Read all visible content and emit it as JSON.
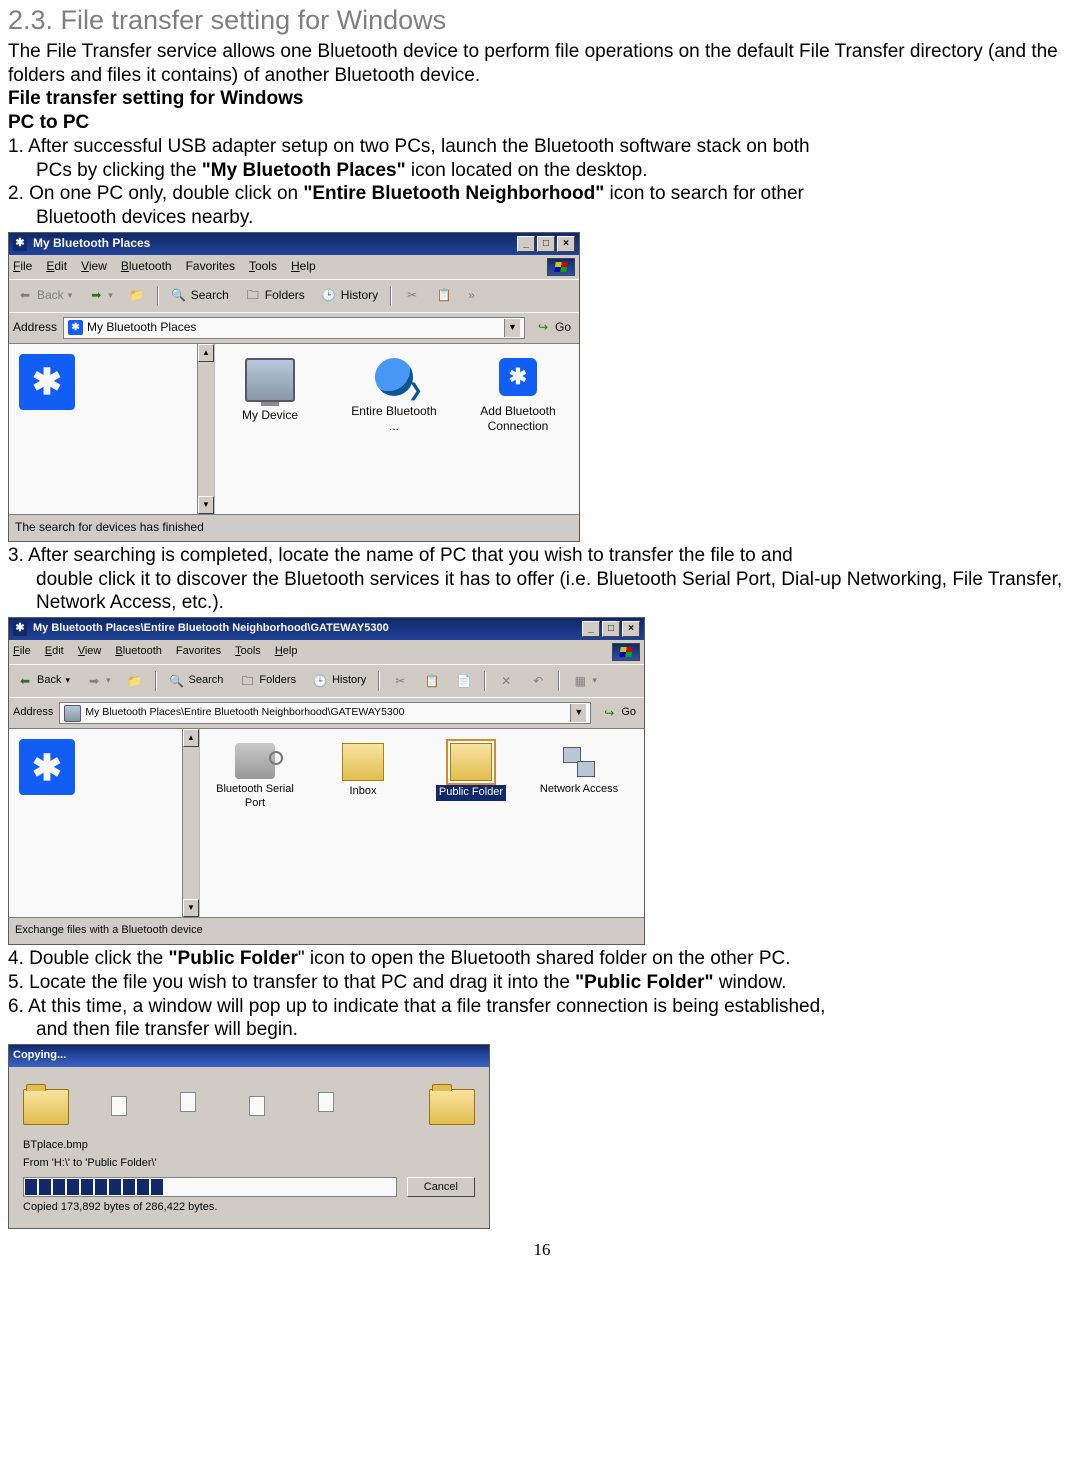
{
  "heading": "2.3. File transfer setting for Windows",
  "intro": "The File Transfer service allows one Bluetooth device to perform file operations on the default File Transfer directory (and the folders and files it contains) of another Bluetooth device.",
  "sub1": "File transfer setting for Windows",
  "sub2": "PC to PC",
  "step1a": "1. After successful USB adapter setup on two PCs, launch the Bluetooth software stack on both",
  "step1b": "PCs by clicking the ",
  "step1bold": "\"My Bluetooth Places\"",
  "step1c": " icon located on the desktop.",
  "step2a": "2. On one PC only, double click on ",
  "step2bold": "\"Entire Bluetooth Neighborhood\"",
  "step2b": " icon to search for other",
  "step2c": "Bluetooth devices nearby.",
  "step3a": "3. After searching is completed, locate the name of PC that you wish to transfer the file to and",
  "step3b": "double click it to discover the Bluetooth services it has to offer (i.e. Bluetooth Serial Port, Dial-up Networking, File Transfer, Network Access, etc.).",
  "step4a": "4. Double click the ",
  "step4bold": "\"Public Folder",
  "step4b": "\" icon to open the Bluetooth shared folder on the other PC.",
  "step5a": "5. Locate the file you wish to transfer to that PC and drag it into the ",
  "step5bold": "\"Public Folder\"",
  "step5b": " window.",
  "step6a": "6. At this time, a window will pop up to indicate that a file transfer connection is being established,",
  "step6b": "and then file transfer will begin.",
  "page": "16",
  "ss1": {
    "title": "My Bluetooth Places",
    "menu": [
      "File",
      "Edit",
      "View",
      "Bluetooth",
      "Favorites",
      "Tools",
      "Help"
    ],
    "back": "Back",
    "search": "Search",
    "folders": "Folders",
    "history": "History",
    "addressLabel": "Address",
    "addressValue": "My Bluetooth Places",
    "go": "Go",
    "icons": [
      {
        "label": "My Device"
      },
      {
        "label": "Entire Bluetooth ..."
      },
      {
        "label": "Add Bluetooth Connection"
      }
    ],
    "status": "The search for devices has finished"
  },
  "ss2": {
    "title": "My Bluetooth Places\\Entire Bluetooth Neighborhood\\GATEWAY5300",
    "menu": [
      "File",
      "Edit",
      "View",
      "Bluetooth",
      "Favorites",
      "Tools",
      "Help"
    ],
    "back": "Back",
    "search": "Search",
    "folders": "Folders",
    "history": "History",
    "addressLabel": "Address",
    "addressValue": "My Bluetooth Places\\Entire Bluetooth Neighborhood\\GATEWAY5300",
    "go": "Go",
    "services": [
      {
        "label": "Bluetooth Serial Port"
      },
      {
        "label": "Inbox"
      },
      {
        "label": "Public Folder"
      },
      {
        "label": "Network Access"
      }
    ],
    "status": "Exchange files with a Bluetooth device"
  },
  "ss3": {
    "title": "Copying...",
    "file": "BTplace.bmp",
    "from": "From 'H:\\' to 'Public Folder\\'",
    "cancel": "Cancel",
    "copied": "Copied 173,892 bytes of 286,422 bytes."
  }
}
